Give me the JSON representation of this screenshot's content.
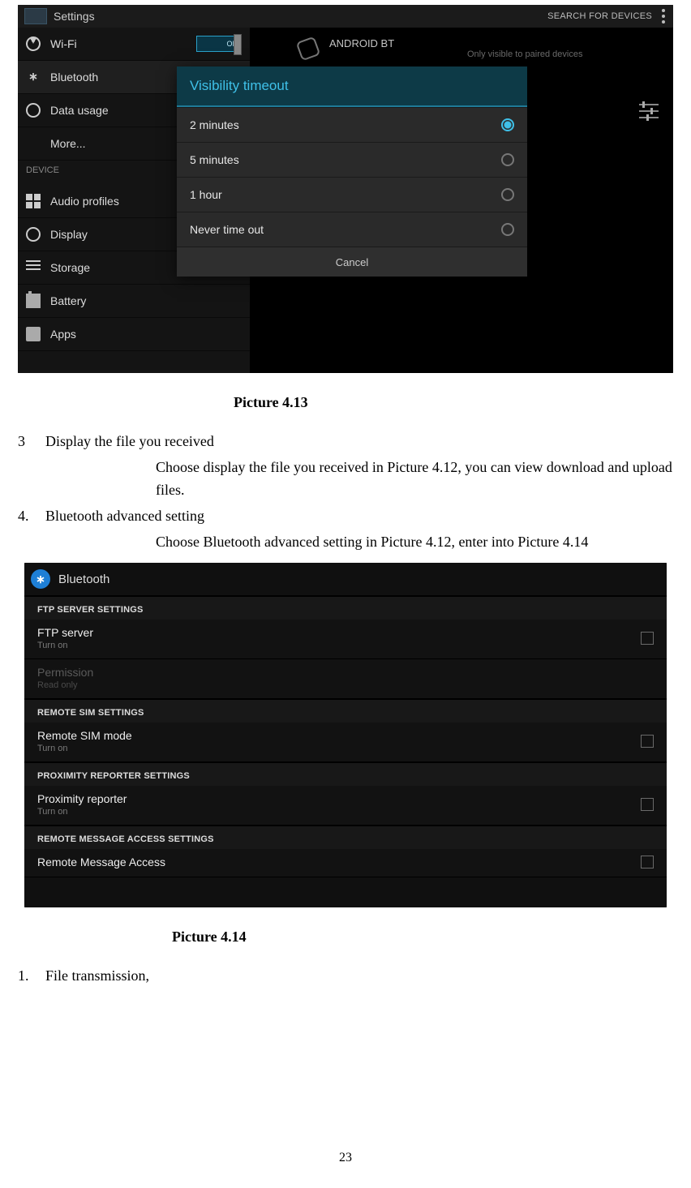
{
  "fig1": {
    "appTitle": "Settings",
    "searchForDevices": "SEARCH FOR DEVICES",
    "left": {
      "wifi": "Wi-Fi",
      "wifiToggle": "ON",
      "bluetooth": "Bluetooth",
      "dataUsage": "Data usage",
      "more": "More...",
      "deviceHeader": "DEVICE",
      "audio": "Audio profiles",
      "display": "Display",
      "storage": "Storage",
      "battery": "Battery",
      "apps": "Apps"
    },
    "right": {
      "deviceName": "ANDROID BT",
      "deviceSub": "Only visible to paired devices"
    },
    "dialog": {
      "title": "Visibility timeout",
      "opt1": "2 minutes",
      "opt2": "5 minutes",
      "opt3": "1 hour",
      "opt4": "Never time out",
      "cancel": "Cancel"
    }
  },
  "caption1": "Picture 4.13",
  "body": {
    "item3num": "3",
    "item3": "Display the file you received",
    "item3sub": "Choose display the file you received in Picture 4.12, you can view download and upload files.",
    "item4num": "4.",
    "item4": "Bluetooth advanced setting",
    "item4sub": "Choose Bluetooth advanced setting in Picture 4.12, enter into Picture 4.14"
  },
  "fig2": {
    "title": "Bluetooth",
    "sec1": "FTP SERVER SETTINGS",
    "row1": "FTP server",
    "row1s": "Turn on",
    "row2": "Permission",
    "row2s": "Read only",
    "sec2": "REMOTE SIM SETTINGS",
    "row3": "Remote SIM mode",
    "row3s": "Turn on",
    "sec3": "PROXIMITY REPORTER SETTINGS",
    "row4": "Proximity reporter",
    "row4s": "Turn on",
    "sec4": "REMOTE MESSAGE ACCESS SETTINGS",
    "row5": "Remote Message Access"
  },
  "caption2": "Picture 4.14",
  "body2": {
    "item1num": "1.",
    "item1": "File transmission,"
  },
  "pageNumber": "23"
}
